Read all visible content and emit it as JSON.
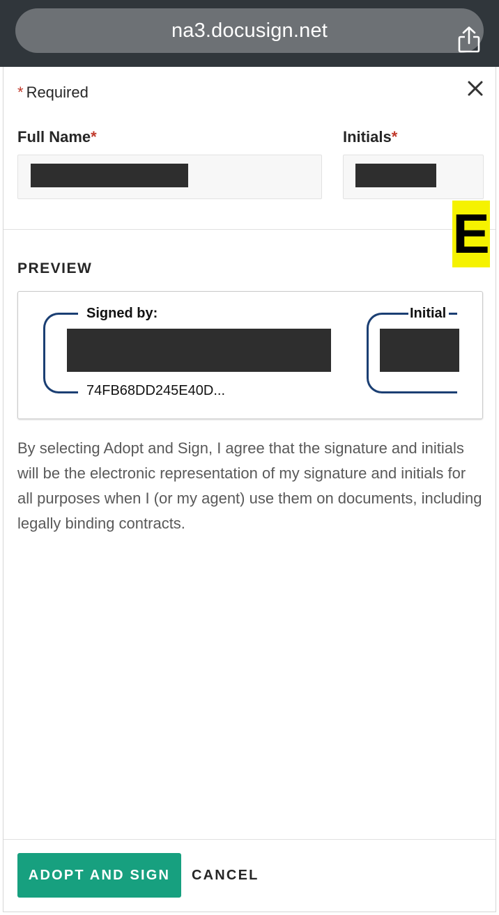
{
  "browser": {
    "url": "na3.docusign.net",
    "share_icon": "share-icon"
  },
  "form": {
    "required_star": "*",
    "required_text": "Required",
    "close_icon": "close-icon",
    "full_name_label": "Full Name",
    "initials_label": "Initials",
    "label_star": "*",
    "full_name_value": "",
    "initials_value": ""
  },
  "marker": "E",
  "preview": {
    "title": "PREVIEW",
    "signed_by_label": "Signed by:",
    "signature_id": "74FB68DD245E40D...",
    "initial_label": "Initial"
  },
  "consent_text": "By selecting Adopt and Sign, I agree that the signature and initials will be the electronic representation of my signature and initials for all purposes when I (or my agent) use them on documents, including legally binding contracts.",
  "actions": {
    "adopt_label": "ADOPT AND SIGN",
    "cancel_label": "CANCEL"
  },
  "colors": {
    "accent": "#17a07f",
    "required": "#c0392b",
    "bracket": "#1b3f73",
    "marker_bg": "#f5f200"
  }
}
